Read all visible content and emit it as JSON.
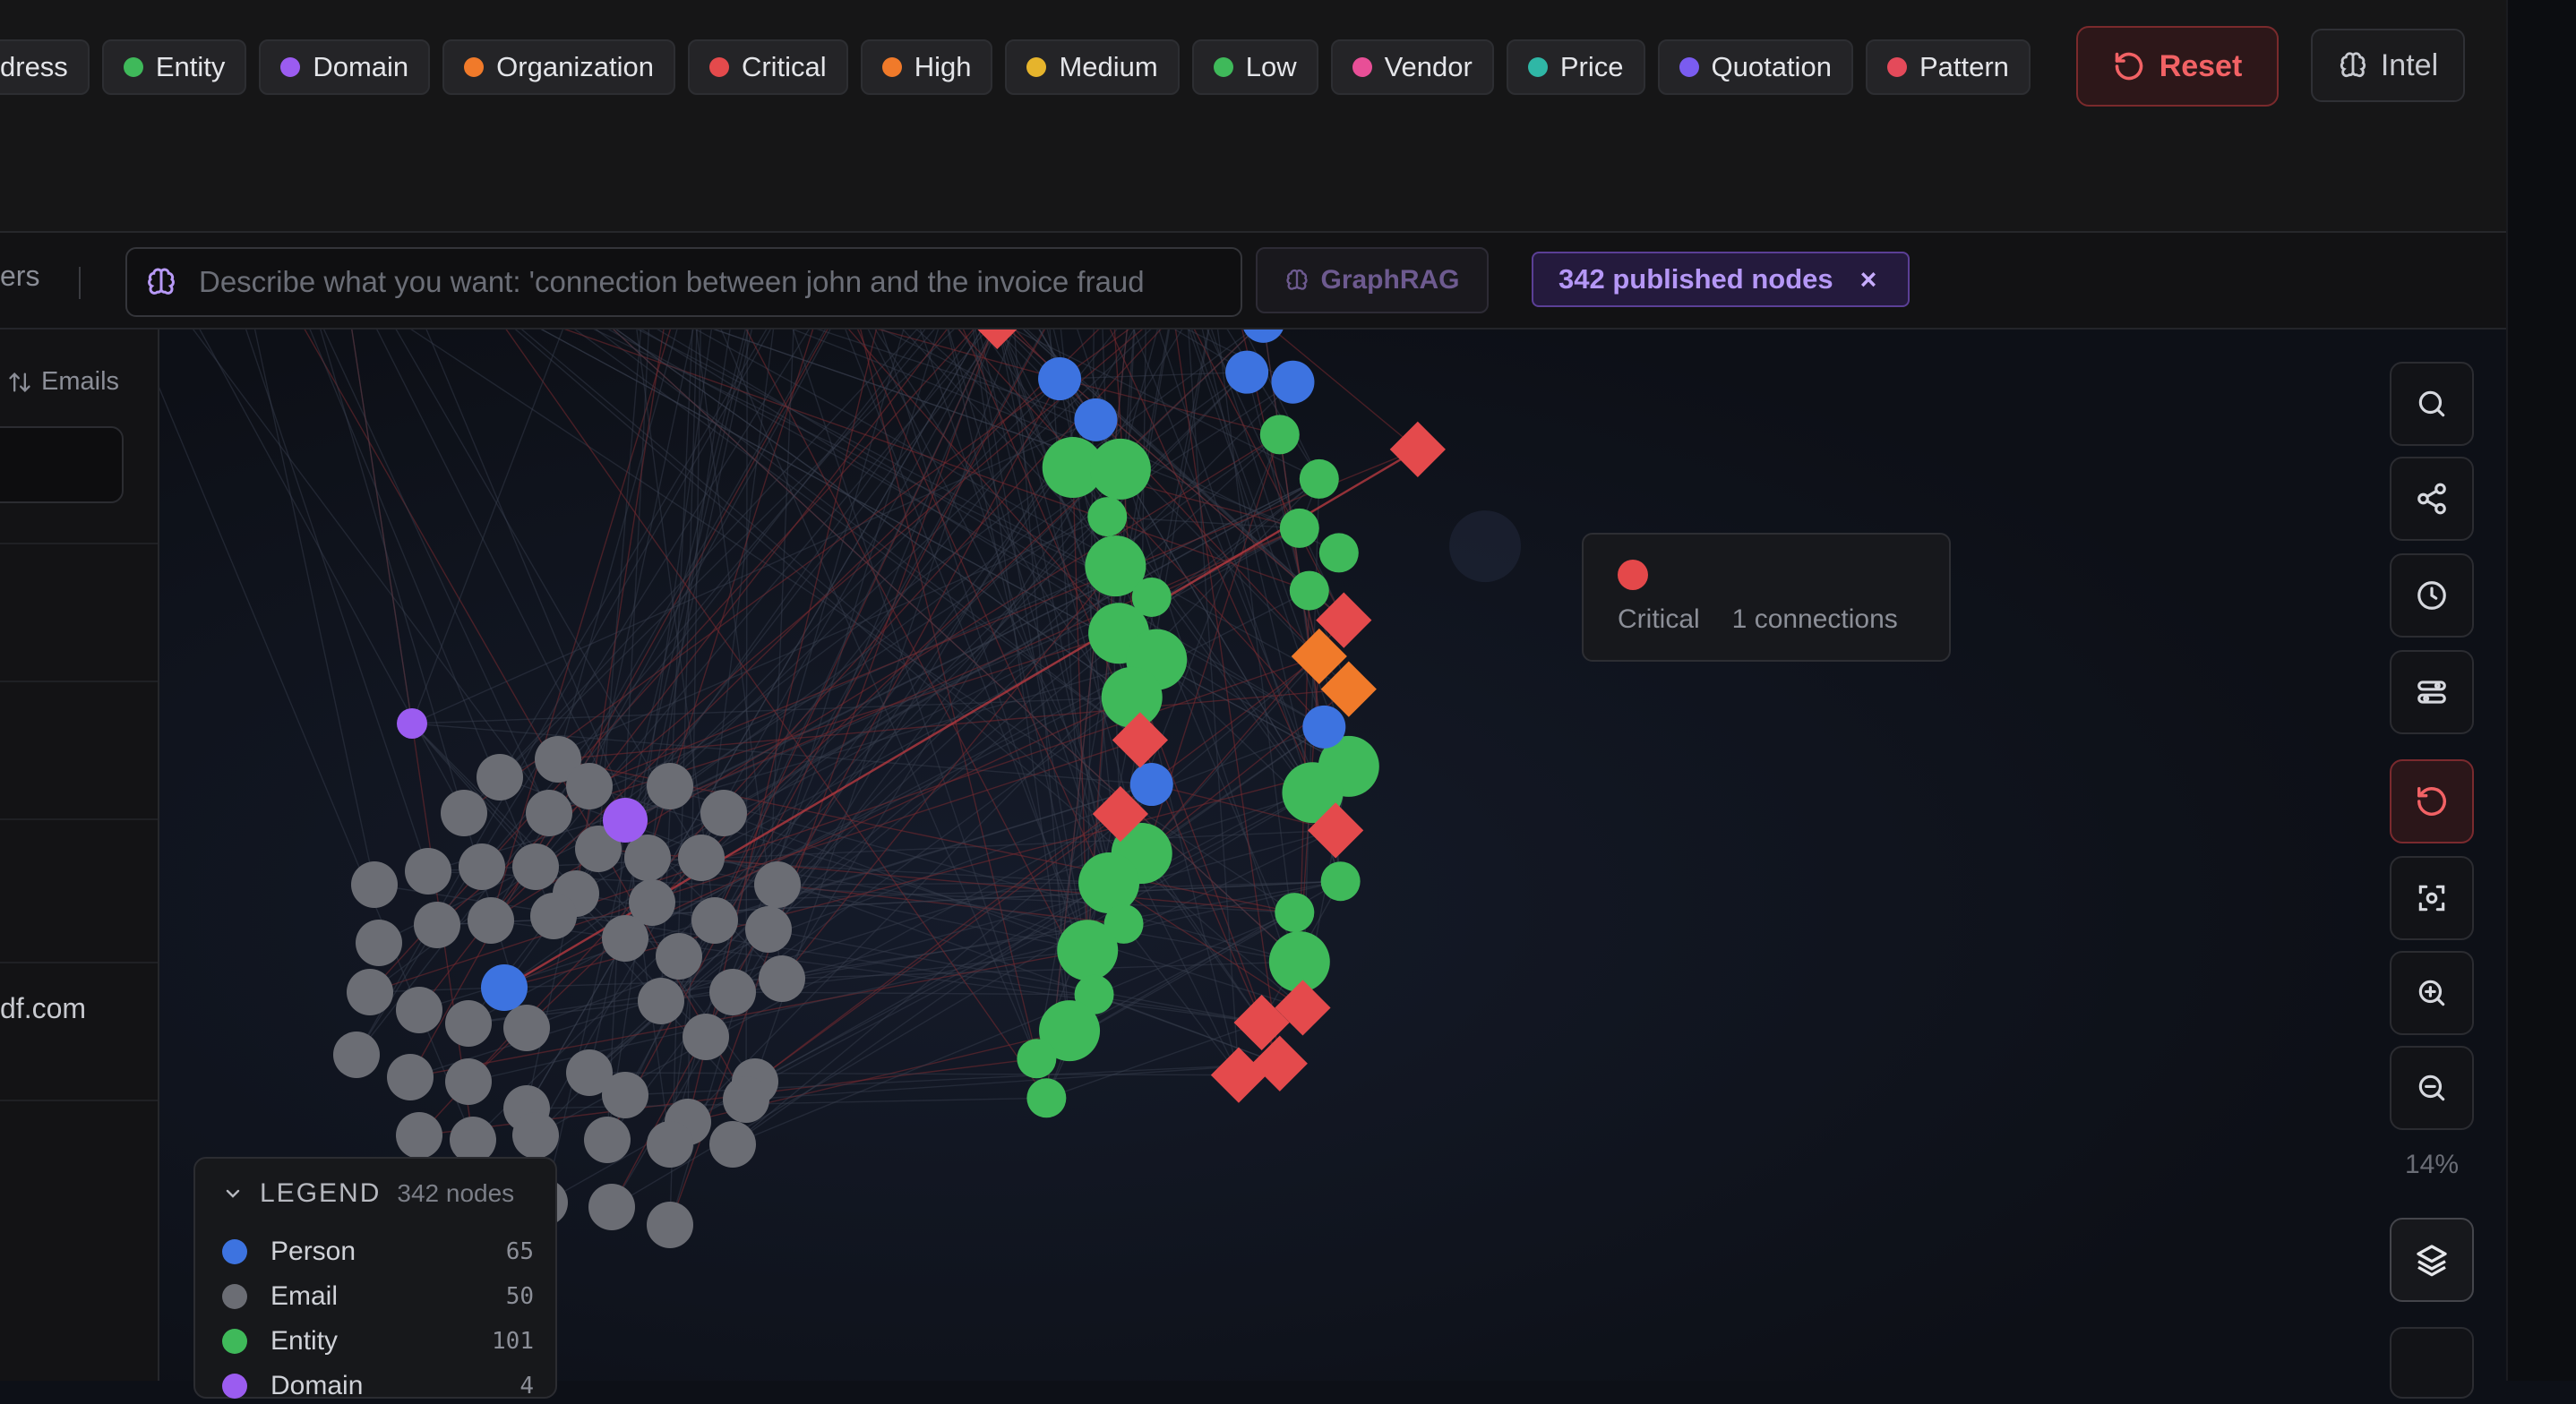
{
  "filters": {
    "chips": [
      {
        "label": "dress",
        "color": "#4a4b50"
      },
      {
        "label": "Entity",
        "color": "#3fb95a"
      },
      {
        "label": "Domain",
        "color": "#9b5cf0"
      },
      {
        "label": "Organization",
        "color": "#f07a2a"
      },
      {
        "label": "Critical",
        "color": "#e44a4c"
      },
      {
        "label": "High",
        "color": "#f07a2a"
      },
      {
        "label": "Medium",
        "color": "#e6b42c"
      },
      {
        "label": "Low",
        "color": "#3fb95a"
      },
      {
        "label": "Vendor",
        "color": "#e84f97"
      },
      {
        "label": "Price",
        "color": "#2fb7a6"
      },
      {
        "label": "Quotation",
        "color": "#7a5cf0"
      },
      {
        "label": "Pattern",
        "color": "#e44a5a"
      }
    ],
    "reset_label": "Reset",
    "intel_label": "Intel"
  },
  "query": {
    "tab_fragment": "ers",
    "placeholder": "Describe what you want: 'connection between john and the invoice fraud",
    "graphrag_label": "GraphRAG",
    "published_label": "342 published nodes",
    "close_symbol": "×"
  },
  "left_panel": {
    "sort_label": "Emails",
    "email_fragment": "df.com"
  },
  "tooltip": {
    "type": "Critical",
    "connections": "1 connections"
  },
  "toolbar": {
    "zoom": "14%",
    "tools": [
      "search-icon",
      "share-icon",
      "clock-icon",
      "filter-icon",
      "reset-icon",
      "focus-icon",
      "zoom-in-icon",
      "zoom-out-icon",
      "layers-icon"
    ]
  },
  "legend": {
    "title": "LEGEND",
    "count": "342 nodes",
    "items": [
      {
        "name": "Person",
        "value": "65",
        "color": "#3d73e0"
      },
      {
        "name": "Email",
        "value": "50",
        "color": "#6b6d74"
      },
      {
        "name": "Entity",
        "value": "101",
        "color": "#3fb95a"
      },
      {
        "name": "Domain",
        "value": "4",
        "color": "#9b5cf0"
      }
    ]
  },
  "colors": {
    "critical": "#e44a4c",
    "high": "#f07a2a",
    "entity": "#3fb95a",
    "person": "#3d73e0",
    "email": "#6b6d74",
    "domain": "#9b5cf0"
  }
}
